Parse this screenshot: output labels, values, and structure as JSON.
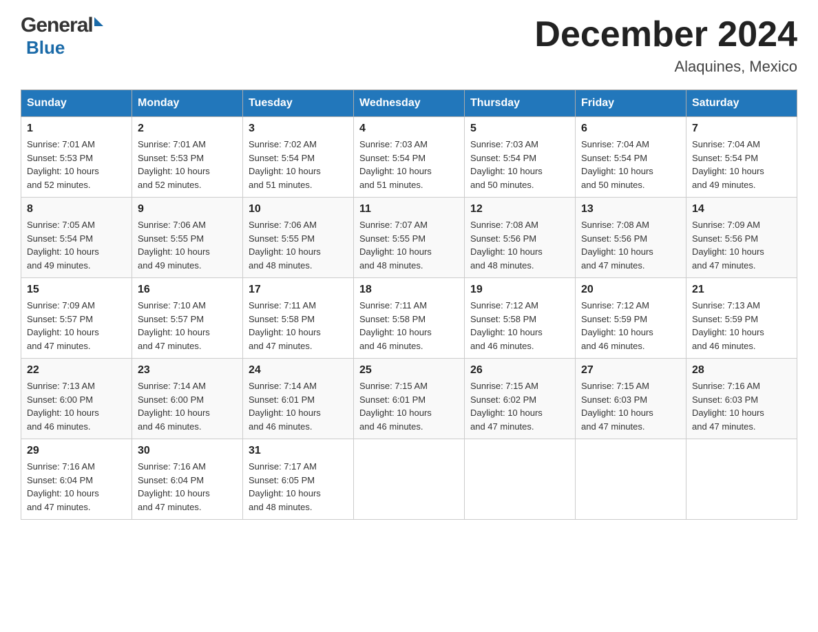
{
  "logo": {
    "general": "General",
    "blue": "Blue"
  },
  "title": {
    "month_year": "December 2024",
    "location": "Alaquines, Mexico"
  },
  "weekdays": [
    "Sunday",
    "Monday",
    "Tuesday",
    "Wednesday",
    "Thursday",
    "Friday",
    "Saturday"
  ],
  "weeks": [
    [
      {
        "day": "1",
        "sunrise": "7:01 AM",
        "sunset": "5:53 PM",
        "daylight": "10 hours and 52 minutes."
      },
      {
        "day": "2",
        "sunrise": "7:01 AM",
        "sunset": "5:53 PM",
        "daylight": "10 hours and 52 minutes."
      },
      {
        "day": "3",
        "sunrise": "7:02 AM",
        "sunset": "5:54 PM",
        "daylight": "10 hours and 51 minutes."
      },
      {
        "day": "4",
        "sunrise": "7:03 AM",
        "sunset": "5:54 PM",
        "daylight": "10 hours and 51 minutes."
      },
      {
        "day": "5",
        "sunrise": "7:03 AM",
        "sunset": "5:54 PM",
        "daylight": "10 hours and 50 minutes."
      },
      {
        "day": "6",
        "sunrise": "7:04 AM",
        "sunset": "5:54 PM",
        "daylight": "10 hours and 50 minutes."
      },
      {
        "day": "7",
        "sunrise": "7:04 AM",
        "sunset": "5:54 PM",
        "daylight": "10 hours and 49 minutes."
      }
    ],
    [
      {
        "day": "8",
        "sunrise": "7:05 AM",
        "sunset": "5:54 PM",
        "daylight": "10 hours and 49 minutes."
      },
      {
        "day": "9",
        "sunrise": "7:06 AM",
        "sunset": "5:55 PM",
        "daylight": "10 hours and 49 minutes."
      },
      {
        "day": "10",
        "sunrise": "7:06 AM",
        "sunset": "5:55 PM",
        "daylight": "10 hours and 48 minutes."
      },
      {
        "day": "11",
        "sunrise": "7:07 AM",
        "sunset": "5:55 PM",
        "daylight": "10 hours and 48 minutes."
      },
      {
        "day": "12",
        "sunrise": "7:08 AM",
        "sunset": "5:56 PM",
        "daylight": "10 hours and 48 minutes."
      },
      {
        "day": "13",
        "sunrise": "7:08 AM",
        "sunset": "5:56 PM",
        "daylight": "10 hours and 47 minutes."
      },
      {
        "day": "14",
        "sunrise": "7:09 AM",
        "sunset": "5:56 PM",
        "daylight": "10 hours and 47 minutes."
      }
    ],
    [
      {
        "day": "15",
        "sunrise": "7:09 AM",
        "sunset": "5:57 PM",
        "daylight": "10 hours and 47 minutes."
      },
      {
        "day": "16",
        "sunrise": "7:10 AM",
        "sunset": "5:57 PM",
        "daylight": "10 hours and 47 minutes."
      },
      {
        "day": "17",
        "sunrise": "7:11 AM",
        "sunset": "5:58 PM",
        "daylight": "10 hours and 47 minutes."
      },
      {
        "day": "18",
        "sunrise": "7:11 AM",
        "sunset": "5:58 PM",
        "daylight": "10 hours and 46 minutes."
      },
      {
        "day": "19",
        "sunrise": "7:12 AM",
        "sunset": "5:58 PM",
        "daylight": "10 hours and 46 minutes."
      },
      {
        "day": "20",
        "sunrise": "7:12 AM",
        "sunset": "5:59 PM",
        "daylight": "10 hours and 46 minutes."
      },
      {
        "day": "21",
        "sunrise": "7:13 AM",
        "sunset": "5:59 PM",
        "daylight": "10 hours and 46 minutes."
      }
    ],
    [
      {
        "day": "22",
        "sunrise": "7:13 AM",
        "sunset": "6:00 PM",
        "daylight": "10 hours and 46 minutes."
      },
      {
        "day": "23",
        "sunrise": "7:14 AM",
        "sunset": "6:00 PM",
        "daylight": "10 hours and 46 minutes."
      },
      {
        "day": "24",
        "sunrise": "7:14 AM",
        "sunset": "6:01 PM",
        "daylight": "10 hours and 46 minutes."
      },
      {
        "day": "25",
        "sunrise": "7:15 AM",
        "sunset": "6:01 PM",
        "daylight": "10 hours and 46 minutes."
      },
      {
        "day": "26",
        "sunrise": "7:15 AM",
        "sunset": "6:02 PM",
        "daylight": "10 hours and 47 minutes."
      },
      {
        "day": "27",
        "sunrise": "7:15 AM",
        "sunset": "6:03 PM",
        "daylight": "10 hours and 47 minutes."
      },
      {
        "day": "28",
        "sunrise": "7:16 AM",
        "sunset": "6:03 PM",
        "daylight": "10 hours and 47 minutes."
      }
    ],
    [
      {
        "day": "29",
        "sunrise": "7:16 AM",
        "sunset": "6:04 PM",
        "daylight": "10 hours and 47 minutes."
      },
      {
        "day": "30",
        "sunrise": "7:16 AM",
        "sunset": "6:04 PM",
        "daylight": "10 hours and 47 minutes."
      },
      {
        "day": "31",
        "sunrise": "7:17 AM",
        "sunset": "6:05 PM",
        "daylight": "10 hours and 48 minutes."
      },
      null,
      null,
      null,
      null
    ]
  ],
  "labels": {
    "sunrise": "Sunrise:",
    "sunset": "Sunset:",
    "daylight": "Daylight:"
  }
}
